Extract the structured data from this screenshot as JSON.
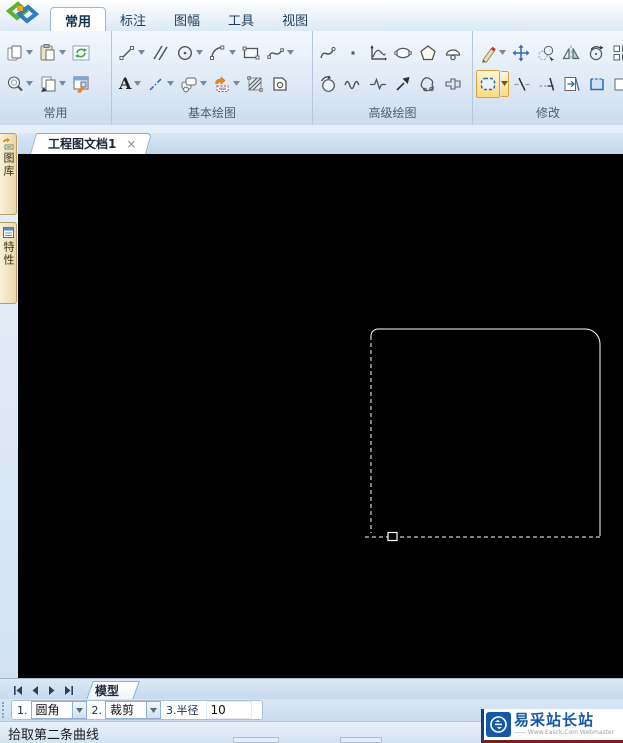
{
  "colors": {
    "canvas_bg": "#000000",
    "selection_line": "#ffffff",
    "active_command_highlight": "#ffd97e",
    "watermark_blue": "#1658a8"
  },
  "ribbon": {
    "tabs": [
      "常用",
      "标注",
      "图幅",
      "工具",
      "视图"
    ],
    "active_tab": "常用",
    "groups": {
      "common": "常用",
      "basic_draw": "基本绘图",
      "advanced_draw": "高级绘图",
      "modify": "修改"
    },
    "text_tool_glyph": "A"
  },
  "document": {
    "tab_title": "工程图文档1",
    "close_glyph": "×"
  },
  "sidebar": {
    "library_tab": "图库",
    "properties_tab": "特性"
  },
  "sheet_bar": {
    "model_tab": "模型"
  },
  "command_bar": {
    "step1_label": "1.",
    "step1_value": "圆角",
    "step2_label": "2.",
    "step2_value": "裁剪",
    "step3_label": "3.半径",
    "step3_value": "10"
  },
  "status_bar": {
    "prompt": "拾取第二条曲线"
  },
  "watermark": {
    "title": "易采站长站",
    "subtitle": "—— Www.Easck.Com Webmaster"
  }
}
